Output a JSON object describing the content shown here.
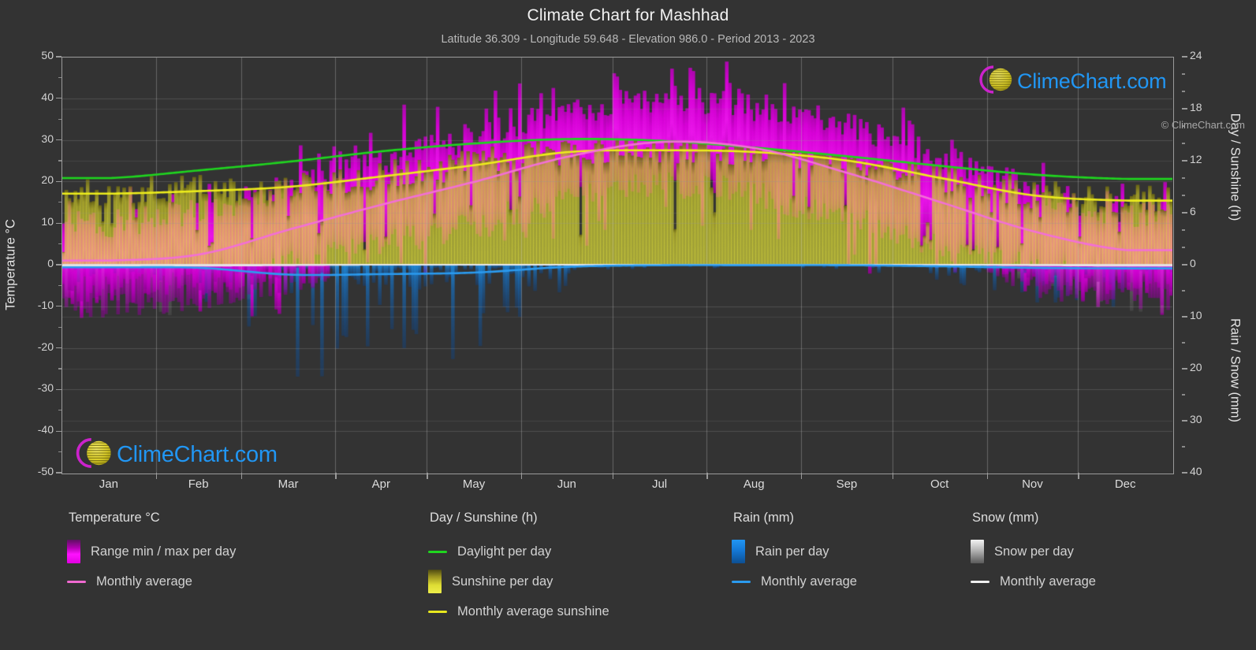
{
  "header": {
    "title": "Climate Chart for Mashhad",
    "subtitle": "Latitude 36.309 - Longitude 59.648 - Elevation 986.0 - Period 2013 - 2023"
  },
  "axes": {
    "left_title": "Temperature °C",
    "left_ticks": [
      "50",
      "40",
      "30",
      "20",
      "10",
      "0",
      "-10",
      "-20",
      "-30",
      "-40",
      "-50"
    ],
    "right_top_title": "Day / Sunshine (h)",
    "right_top_ticks": [
      "24",
      "18",
      "12",
      "6",
      "0"
    ],
    "right_bottom_title": "Rain / Snow (mm)",
    "right_bottom_ticks": [
      "0",
      "10",
      "20",
      "30",
      "40"
    ],
    "x_ticks": [
      "Jan",
      "Feb",
      "Mar",
      "Apr",
      "May",
      "Jun",
      "Jul",
      "Aug",
      "Sep",
      "Oct",
      "Nov",
      "Dec"
    ]
  },
  "legend": {
    "groups": [
      {
        "title": "Temperature °C",
        "items": [
          {
            "label": "Range min / max per day",
            "type": "swatch",
            "color": "#e800e8"
          },
          {
            "label": "Monthly average",
            "type": "line",
            "color": "#f06ad0"
          }
        ]
      },
      {
        "title": "Day / Sunshine (h)",
        "items": [
          {
            "label": "Daylight per day",
            "type": "line",
            "color": "#1fd61f"
          },
          {
            "label": "Sunshine per day",
            "type": "swatch",
            "color": "#e6e62e"
          },
          {
            "label": "Monthly average sunshine",
            "type": "line",
            "color": "#e8e81e"
          }
        ]
      },
      {
        "title": "Rain (mm)",
        "items": [
          {
            "label": "Rain per day",
            "type": "swatch",
            "color": "#1283e0"
          },
          {
            "label": "Monthly average",
            "type": "line",
            "color": "#2b9bef"
          }
        ]
      },
      {
        "title": "Snow (mm)",
        "items": [
          {
            "label": "Snow per day",
            "type": "swatch",
            "color": "#e3e3e3"
          },
          {
            "label": "Monthly average",
            "type": "line",
            "color": "#f0f0f0"
          }
        ]
      }
    ],
    "copyright": "© ClimeChart.com"
  },
  "watermark": {
    "text": "ClimeChart.com"
  },
  "colors": {
    "background": "#333333",
    "grid": "#4d4d4d",
    "axis": "#9a9a9a",
    "temp_range": "#e800e8",
    "temp_avg": "#f36fd6",
    "daylight": "#1fd61f",
    "sunshine_bar": "#cfcf33",
    "sunshine_avg": "#eded1c",
    "rain": "#1283e0",
    "rain_avg": "#2b9bef",
    "snow": "#cfcfcf",
    "snow_avg": "#e8e8e8",
    "logo_text": "#2196f3",
    "logo_arc": "#cc22cc",
    "logo_sphere": "#d4c820"
  },
  "chart_data": {
    "type": "area",
    "title": "Climate Chart for Mashhad",
    "subtitle": "Latitude 36.309 - Longitude 59.648 - Elevation 986.0 - Period 2013 - 2023",
    "xlabel": "",
    "ylabel": "Temperature °C",
    "ylim": [
      -50,
      50
    ],
    "y2lim_day_sunshine": [
      0,
      24
    ],
    "y2lim_rain_snow": [
      0,
      40
    ],
    "grid": true,
    "legend_position": "bottom",
    "categories": [
      "Jan",
      "Feb",
      "Mar",
      "Apr",
      "May",
      "Jun",
      "Jul",
      "Aug",
      "Sep",
      "Oct",
      "Nov",
      "Dec"
    ],
    "series": [
      {
        "name": "Monthly average temperature (°C)",
        "axis": "left",
        "color": "#f36fd6",
        "values": [
          1.0,
          2.5,
          8.5,
          14.5,
          20.0,
          26.0,
          29.5,
          28.0,
          22.0,
          15.0,
          8.0,
          3.5
        ]
      },
      {
        "name": "Daily max temperature (°C)",
        "axis": "left",
        "color": "#e800e8",
        "values": [
          10.0,
          13.0,
          19.0,
          25.0,
          31.0,
          37.0,
          39.0,
          38.0,
          33.0,
          26.0,
          18.0,
          12.0
        ]
      },
      {
        "name": "Daily min temperature (°C)",
        "axis": "left",
        "color": "#e800e8",
        "values": [
          -6.0,
          -4.0,
          0.0,
          5.0,
          10.0,
          15.0,
          19.0,
          17.0,
          11.0,
          5.0,
          -1.0,
          -4.0
        ]
      },
      {
        "name": "Daylight per day (h)",
        "axis": "right-top",
        "color": "#1fd61f",
        "values": [
          10.0,
          10.9,
          11.9,
          13.1,
          14.0,
          14.5,
          14.3,
          13.5,
          12.5,
          11.4,
          10.4,
          9.9
        ]
      },
      {
        "name": "Monthly average sunshine (h)",
        "axis": "right-top",
        "color": "#eded1c",
        "values": [
          8.2,
          8.5,
          9.0,
          10.2,
          11.5,
          13.0,
          13.2,
          13.0,
          12.0,
          10.0,
          8.0,
          7.4
        ]
      },
      {
        "name": "Monthly average rain (mm)",
        "axis": "right-bottom",
        "color": "#2b9bef",
        "values": [
          0.5,
          0.6,
          1.9,
          1.8,
          1.5,
          0.4,
          0.1,
          0.1,
          0.1,
          0.3,
          0.6,
          0.7
        ]
      },
      {
        "name": "Monthly average snow (mm)",
        "axis": "right-bottom",
        "color": "#e8e8e8",
        "values": [
          0.2,
          0.2,
          0.1,
          0.0,
          0.0,
          0.0,
          0.0,
          0.0,
          0.0,
          0.0,
          0.1,
          0.2
        ]
      }
    ],
    "annotations": [
      "ClimeChart.com watermark top-right",
      "ClimeChart.com watermark bottom-left"
    ]
  }
}
